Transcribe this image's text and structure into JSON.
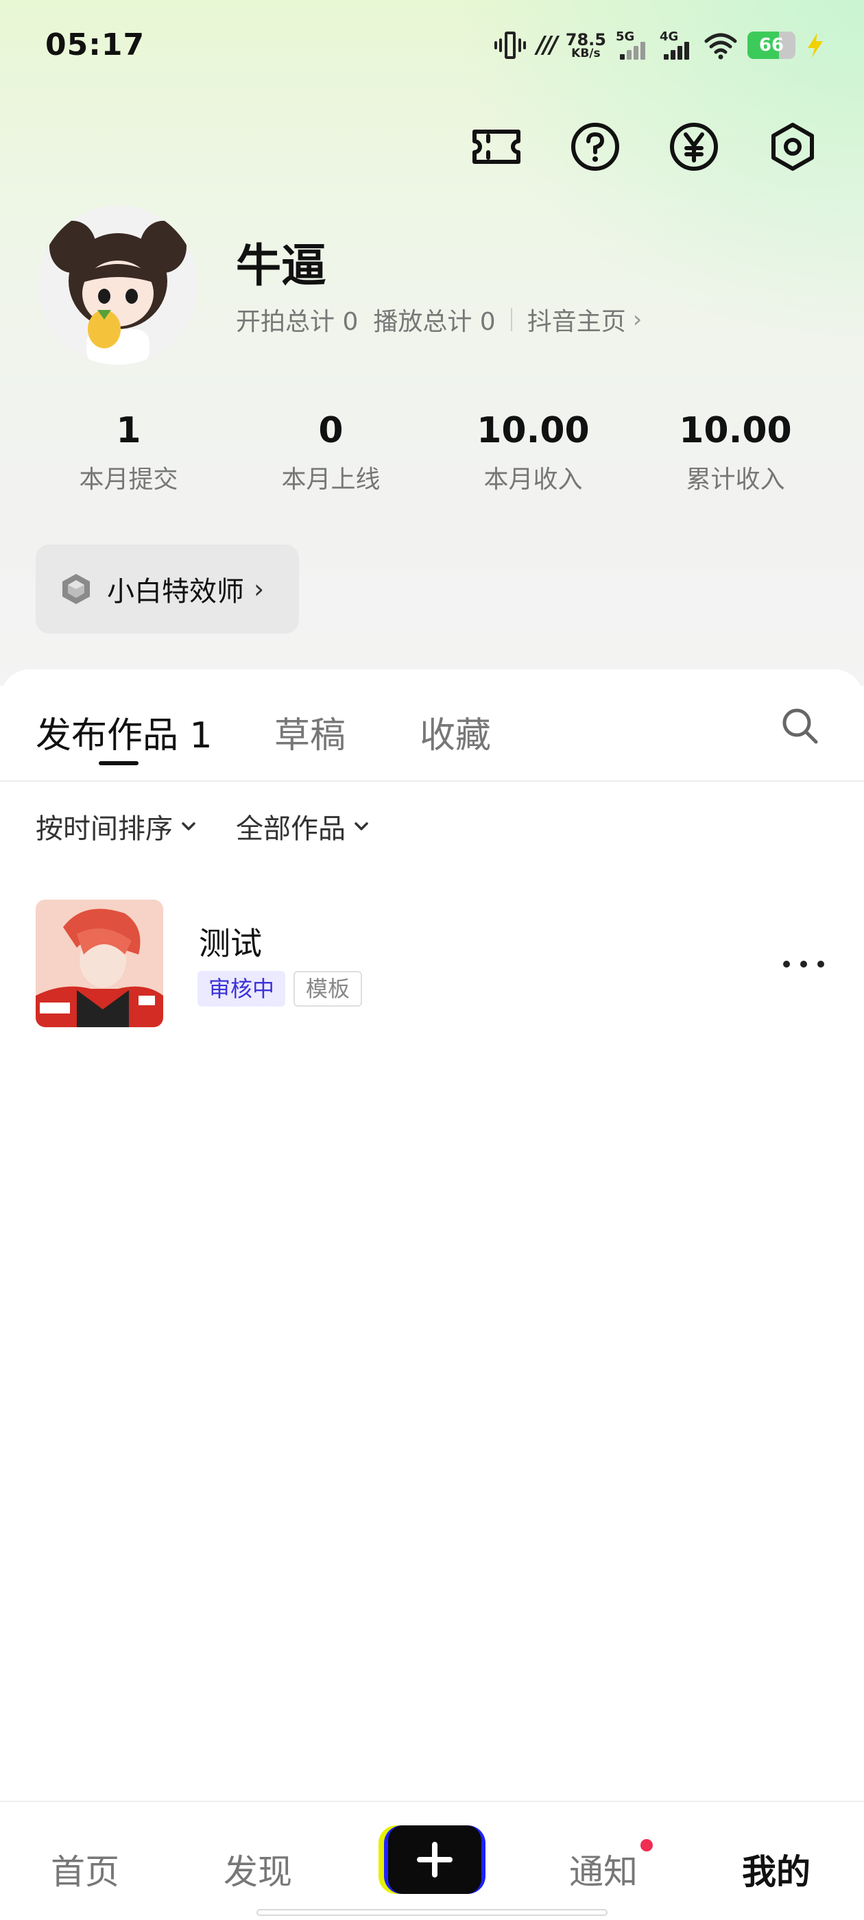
{
  "status_bar": {
    "time": "05:17",
    "net_speed_value": "78.5",
    "net_speed_unit": "KB/s",
    "signal1_label": "5G",
    "signal2_label": "4G",
    "battery": "66",
    "battery_level": 0.66,
    "hd_label": "///"
  },
  "top_actions": {
    "icons": [
      "ticket-icon",
      "help-icon",
      "yuan-icon",
      "settings-icon"
    ]
  },
  "profile": {
    "name": "牛逼",
    "shoot_total": "开拍总计 0",
    "play_total": "播放总计 0",
    "douyin_link": "抖音主页",
    "douyin_chevron": "›"
  },
  "stats": [
    {
      "value": "1",
      "label": "本月提交"
    },
    {
      "value": "0",
      "label": "本月上线"
    },
    {
      "value": "10.00",
      "label": "本月收入"
    },
    {
      "value": "10.00",
      "label": "累计收入"
    }
  ],
  "level_badge": {
    "label": "小白特效师",
    "chevron": "›"
  },
  "tabs": [
    {
      "label": "发布作品 1",
      "active": true
    },
    {
      "label": "草稿",
      "active": false
    },
    {
      "label": "收藏",
      "active": false
    }
  ],
  "filters": [
    {
      "label": "按时间排序"
    },
    {
      "label": "全部作品"
    }
  ],
  "works": [
    {
      "title": "测试",
      "status_tag": "审核中",
      "type_tag": "模板"
    }
  ],
  "bottom_nav": {
    "items": [
      {
        "label": "首页"
      },
      {
        "label": "发现"
      },
      {
        "label": "通知"
      },
      {
        "label": "我的"
      }
    ],
    "has_notification_dot": true
  },
  "colors": {
    "accent_review": "#3b32d8",
    "notif_dot": "#f02d52",
    "create_yellow": "#e6f000",
    "create_blue": "#1e22ff"
  }
}
